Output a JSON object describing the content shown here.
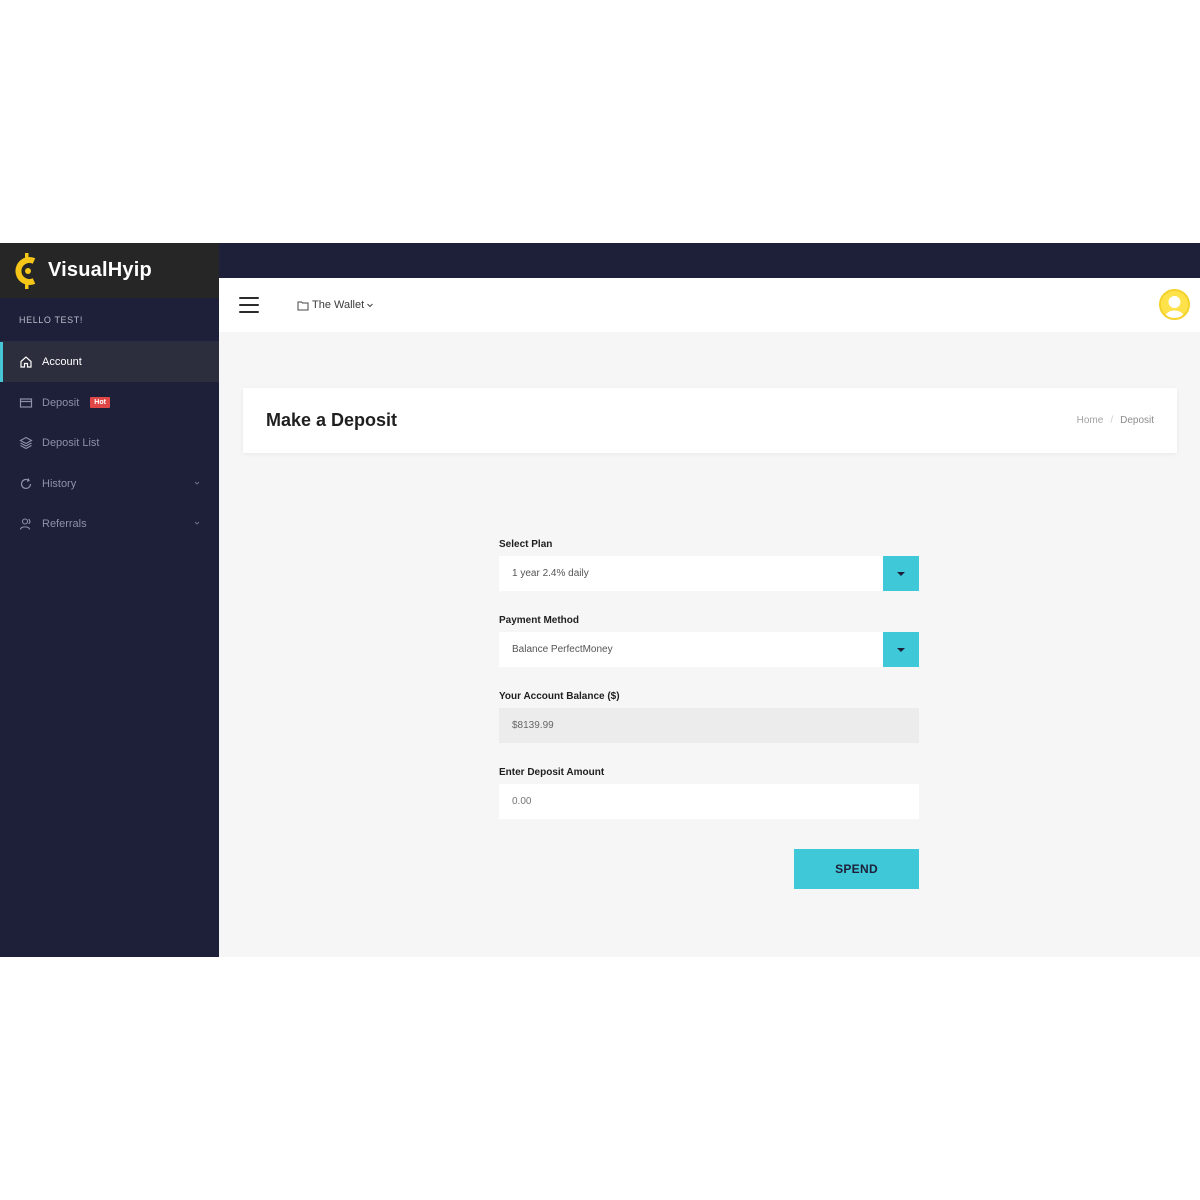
{
  "brand": {
    "name": "VisualHyip",
    "accent": "#f5c518"
  },
  "sidebar": {
    "greeting": "HELLO TEST!",
    "items": [
      {
        "label": "Account",
        "icon": "home-icon",
        "active": true
      },
      {
        "label": "Deposit",
        "icon": "card-icon",
        "badge": "Hot"
      },
      {
        "label": "Deposit List",
        "icon": "layers-icon"
      },
      {
        "label": "History",
        "icon": "refresh-icon",
        "expandable": true
      },
      {
        "label": "Referrals",
        "icon": "users-icon",
        "expandable": true
      }
    ]
  },
  "header": {
    "wallet_label": "The Wallet",
    "menu_icon": "hamburger-icon",
    "avatar_icon": "user-avatar-icon"
  },
  "page": {
    "title": "Make a Deposit",
    "breadcrumb": [
      "Home",
      "Deposit"
    ]
  },
  "form": {
    "plan_label": "Select Plan",
    "plan_value": "1 year 2.4% daily",
    "method_label": "Payment Method",
    "method_value": "Balance PerfectMoney",
    "balance_label": "Your Account Balance ($)",
    "balance_value": "$8139.99",
    "amount_label": "Enter Deposit Amount",
    "amount_placeholder": "0.00",
    "submit_label": "SPEND"
  },
  "colors": {
    "sidebar_bg": "#1e1f38",
    "accent": "#3fc9d8",
    "badge": "#e04848"
  }
}
